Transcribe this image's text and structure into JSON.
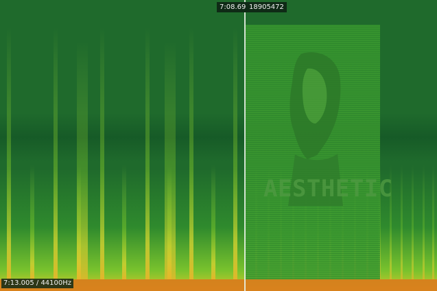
{
  "spectrogram": {
    "cursor_time": "7:08.695",
    "cursor_sample": "18905472",
    "status": "7:13.005 / 44100Hz",
    "hidden_image_text": "AESTHETIC",
    "colors": {
      "background": "#1f6a2c",
      "low": "#1a5f2a",
      "mid": "#2f8a2d",
      "high": "#8ed428",
      "peak": "#e3d22e",
      "hot": "#e17a1a",
      "cursor": "#e9f1e6"
    }
  }
}
